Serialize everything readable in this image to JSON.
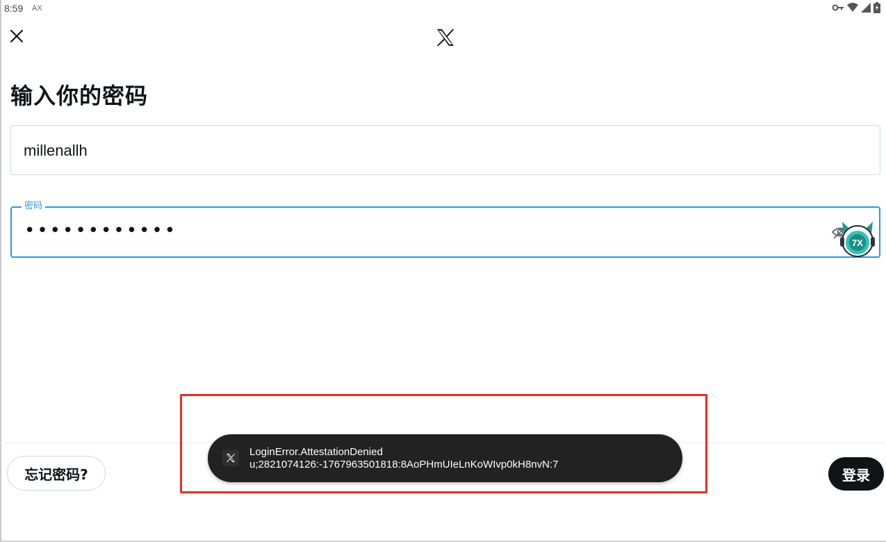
{
  "status_bar": {
    "time": "8:59",
    "indicator": "AX",
    "icons": [
      "vpn-key-icon",
      "wifi-icon",
      "cell-signal-icon",
      "battery-icon"
    ]
  },
  "header": {
    "close_icon": "close-icon",
    "logo_icon": "x-logo-icon"
  },
  "main": {
    "title": "输入你的密码",
    "username_value": "millenallh",
    "password": {
      "label": "密码",
      "masked_value": "••••••••••••",
      "toggle_icon": "eye-off-icon"
    }
  },
  "footer": {
    "forgot_label": "忘记密码?",
    "login_label": "登录"
  },
  "toast": {
    "line1": "LoginError.AttestationDenied",
    "line2": "u;2821074126:-1767963501818:8AoPHmUIeLnKoWIvp0kH8nvN:7",
    "icon": "x-logo-icon"
  },
  "colors": {
    "accent": "#1d9bf0",
    "text": "#0f1419",
    "toast_bg": "#222222",
    "highlight": "#ee2a24",
    "button_dark": "#0f1419"
  }
}
